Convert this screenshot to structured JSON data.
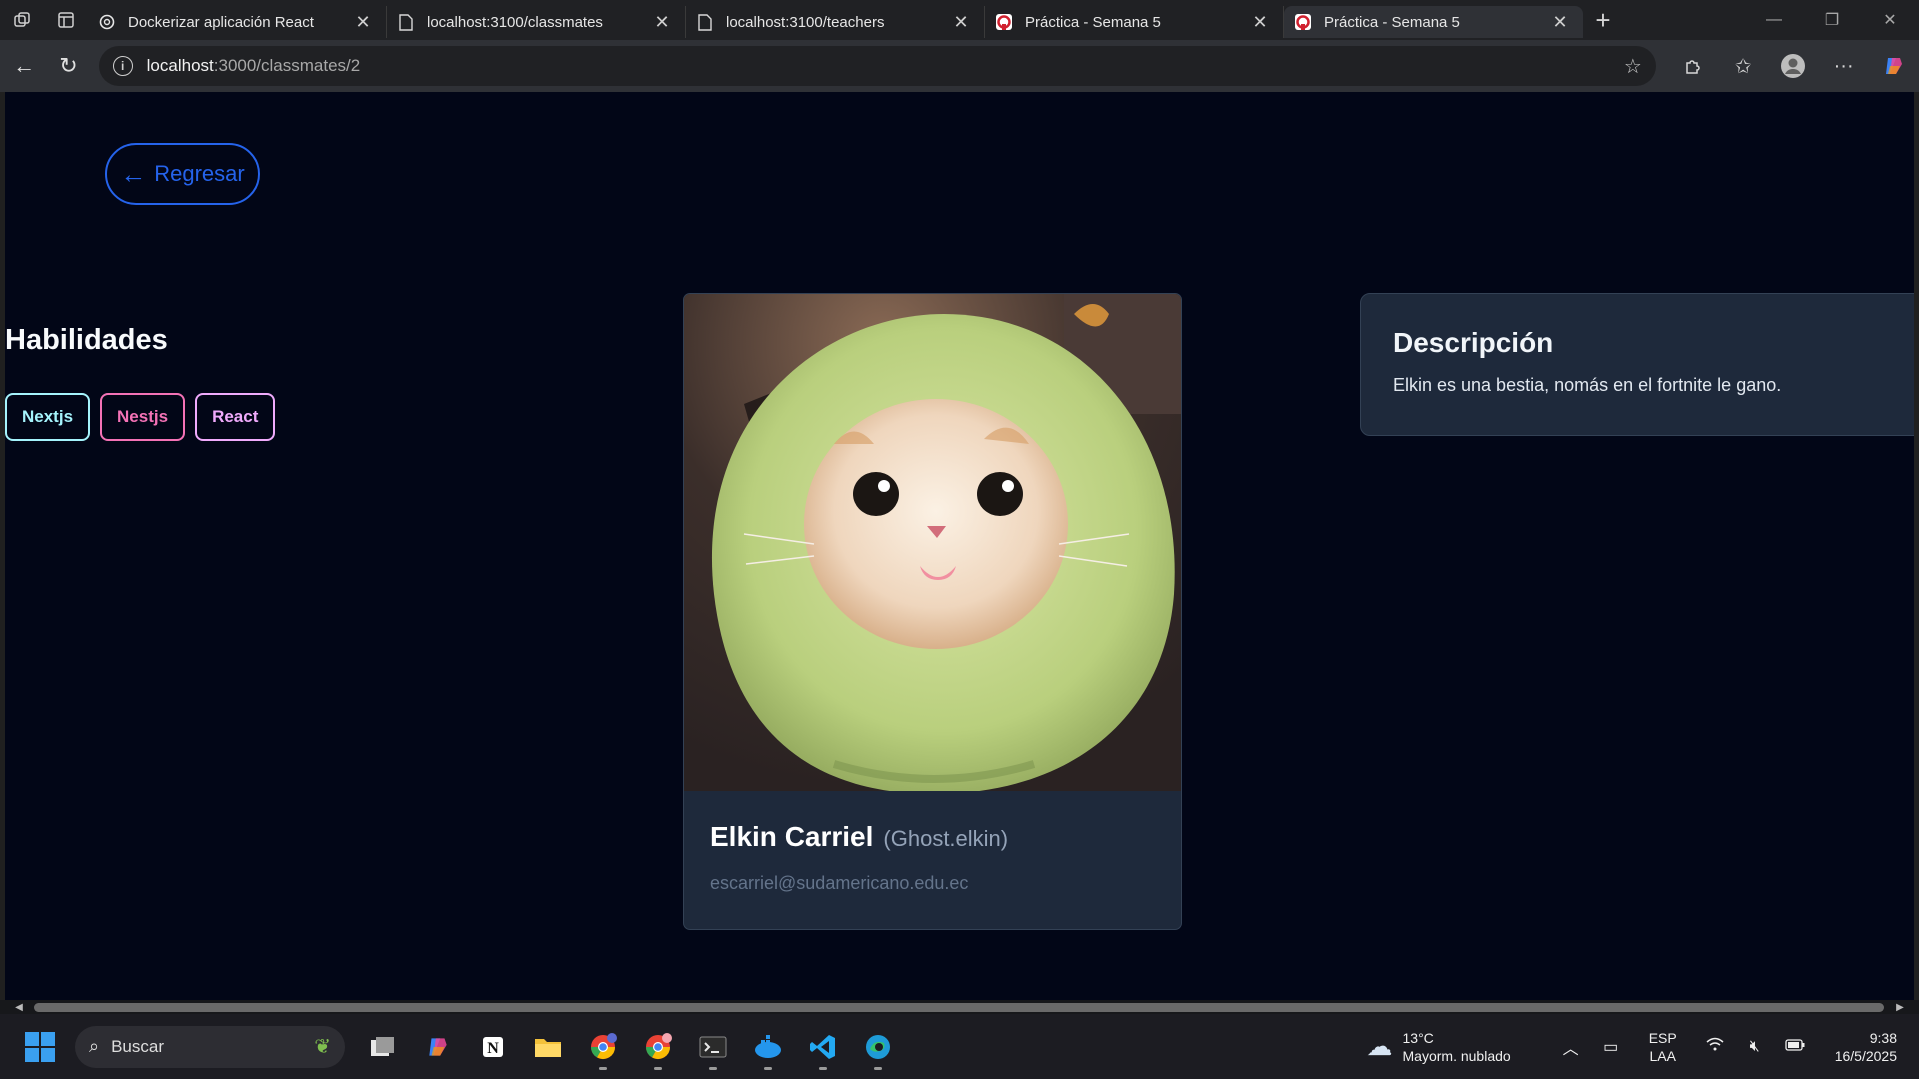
{
  "browser": {
    "tabs": [
      {
        "title": "Dockerizar aplicación React",
        "favicon": "openai-icon",
        "active": false
      },
      {
        "title": "localhost:3100/classmates",
        "favicon": "page-icon",
        "active": false
      },
      {
        "title": "localhost:3100/teachers",
        "favicon": "page-icon",
        "active": false
      },
      {
        "title": "Práctica - Semana 5",
        "favicon": "app-red-icon",
        "active": false
      },
      {
        "title": "Práctica - Semana 5",
        "favicon": "app-red-icon",
        "active": true
      }
    ],
    "url_host": "localhost",
    "url_path": ":3000/classmates/2"
  },
  "page": {
    "back_label": "Regresar",
    "skills_title": "Habilidades",
    "skills": [
      {
        "label": "Nextjs",
        "color": "#a5f3fc"
      },
      {
        "label": "Nestjs",
        "color": "#f472b6"
      },
      {
        "label": "React",
        "color": "#f0abfc"
      }
    ],
    "profile": {
      "name": "Elkin Carriel",
      "nickname": "(Ghost.elkin)",
      "email": "escarriel@sudamericano.edu.ec"
    },
    "description": {
      "title": "Descripción",
      "text": "Elkin es una bestia, nomás en el fortnite le gano."
    }
  },
  "taskbar": {
    "search_placeholder": "Buscar",
    "weather_temp": "13°C",
    "weather_desc": "Mayorm. nublado",
    "lang_top": "ESP",
    "lang_bottom": "LAA",
    "time": "9:38",
    "date": "16/5/2025"
  },
  "colors": {
    "page_bg": "#020617",
    "card_bg": "#1e293b",
    "accent_blue": "#2563eb"
  }
}
